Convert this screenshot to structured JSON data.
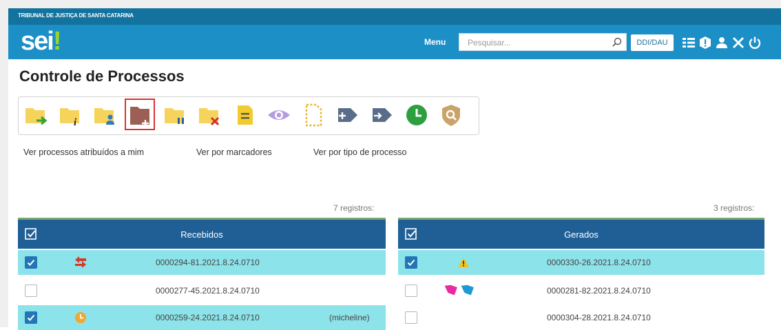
{
  "header": {
    "org_name": "TRIBUNAL DE JUSTIÇA DE SANTA CATARINA",
    "logo_text": "sei",
    "logo_mark": "!",
    "menu_label": "Menu",
    "search_placeholder": "Pesquisar...",
    "unit_label": "DDI/DAU",
    "icons": [
      "search-icon",
      "list-grid-icon",
      "alert-icon",
      "user-icon",
      "tools-icon",
      "power-icon"
    ]
  },
  "page": {
    "title": "Controle de Processos"
  },
  "toolbar": {
    "buttons": [
      {
        "name": "send-process",
        "icon": "folder-arrow-icon"
      },
      {
        "name": "process-info",
        "icon": "folder-info-icon"
      },
      {
        "name": "assign-process",
        "icon": "folder-user-icon"
      },
      {
        "name": "new-process",
        "icon": "folder-plus-icon",
        "highlighted": true
      },
      {
        "name": "suspend-process",
        "icon": "folder-pause-icon"
      },
      {
        "name": "close-process",
        "icon": "folder-x-icon"
      },
      {
        "name": "annotation",
        "icon": "note-icon"
      },
      {
        "name": "view",
        "icon": "eye-icon"
      },
      {
        "name": "block",
        "icon": "dashed-doc-icon"
      },
      {
        "name": "add-marker",
        "icon": "tag-plus-icon"
      },
      {
        "name": "marker",
        "icon": "tag-arrow-icon"
      },
      {
        "name": "deadline",
        "icon": "clock-icon"
      },
      {
        "name": "security",
        "icon": "shield-icon"
      }
    ]
  },
  "views": {
    "assigned": "Ver processos atribuídos a mim",
    "by_marker": "Ver por marcadores",
    "by_type": "Ver por tipo de processo"
  },
  "received": {
    "count_label": "7 registros:",
    "title": "Recebidos",
    "rows": [
      {
        "number": "0000294-81.2021.8.24.0710",
        "checked": true,
        "icon": "arrows-icon",
        "note": ""
      },
      {
        "number": "0000277-45.2021.8.24.0710",
        "checked": false,
        "icon": "",
        "note": ""
      },
      {
        "number": "0000259-24.2021.8.24.0710",
        "checked": true,
        "icon": "clock-icon",
        "note": "(micheline)"
      }
    ]
  },
  "generated": {
    "count_label": "3 registros:",
    "title": "Gerados",
    "rows": [
      {
        "number": "0000330-26.2021.8.24.0710",
        "checked": true,
        "icon": "warning-icon"
      },
      {
        "number": "0000281-82.2021.8.24.0710",
        "checked": false,
        "icon": "tags-icon"
      },
      {
        "number": "0000304-28.2021.8.24.0710",
        "checked": false,
        "icon": ""
      }
    ]
  },
  "colors": {
    "header_blue": "#1c8fc7",
    "panel_blue": "#1f5f96",
    "row_selected": "#8de3ea",
    "logo_green": "#99d42c",
    "highlight_red": "#d83232"
  }
}
